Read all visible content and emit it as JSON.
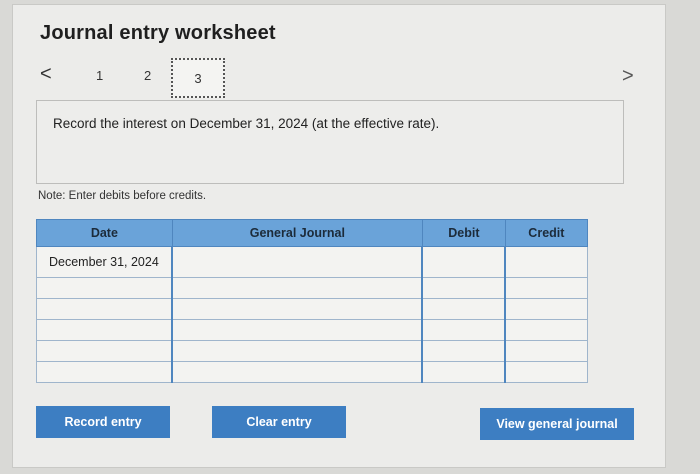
{
  "header": {
    "title": "Journal entry worksheet"
  },
  "pager": {
    "prev": "<",
    "next": ">",
    "pages": [
      "1",
      "2",
      "3"
    ],
    "current": "3"
  },
  "instruction": "Record the interest on December 31, 2024 (at the effective rate).",
  "note": "Note: Enter debits before credits.",
  "table": {
    "headers": {
      "date": "Date",
      "journal": "General Journal",
      "debit": "Debit",
      "credit": "Credit"
    },
    "rows": [
      {
        "date": "December 31, 2024",
        "account": "",
        "debit": "",
        "credit": ""
      },
      {
        "date": "",
        "account": "",
        "debit": "",
        "credit": ""
      },
      {
        "date": "",
        "account": "",
        "debit": "",
        "credit": ""
      },
      {
        "date": "",
        "account": "",
        "debit": "",
        "credit": ""
      },
      {
        "date": "",
        "account": "",
        "debit": "",
        "credit": ""
      },
      {
        "date": "",
        "account": "",
        "debit": "",
        "credit": ""
      }
    ]
  },
  "buttons": {
    "record": "Record entry",
    "clear": "Clear entry",
    "view": "View general journal"
  }
}
